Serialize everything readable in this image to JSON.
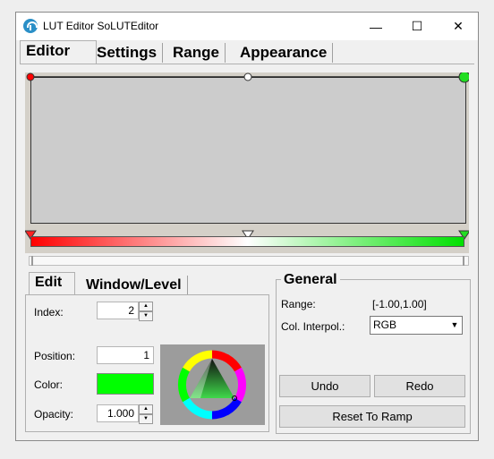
{
  "window": {
    "title": "LUT Editor SoLUTEditor",
    "minimize": "—",
    "maximize": "☐",
    "close": "✕"
  },
  "tabs": [
    {
      "label": "Editor",
      "active": true
    },
    {
      "label": "Settings",
      "active": false
    },
    {
      "label": "Range",
      "active": false
    },
    {
      "label": "Appearance",
      "active": false
    }
  ],
  "lut": {
    "curve_points": [
      {
        "position": 0,
        "color": "#ff0000"
      },
      {
        "position": 0.5,
        "color": "#ffffff"
      },
      {
        "position": 1,
        "color": "#00e000"
      }
    ],
    "gradient": [
      "#ff0000",
      "#ffffff",
      "#00e000"
    ]
  },
  "subtabs": [
    {
      "label": "Edit",
      "active": true
    },
    {
      "label": "Window/Level",
      "active": false
    }
  ],
  "edit": {
    "index_label": "Index:",
    "index_value": "2",
    "position_label": "Position:",
    "position_value": "1",
    "color_label": "Color:",
    "color_value": "#00ff00",
    "opacity_label": "Opacity:",
    "opacity_value": "1.000"
  },
  "general": {
    "title": "General",
    "range_label": "Range:",
    "range_value": "[-1.00,1.00]",
    "interp_label": "Col. Interpol.:",
    "interp_value": "RGB",
    "undo": "Undo",
    "redo": "Redo",
    "reset": "Reset To Ramp"
  },
  "icons": {
    "app": "app-logo-icon",
    "spin_up": "▲",
    "spin_down": "▼",
    "combo_arrow": "▼"
  }
}
